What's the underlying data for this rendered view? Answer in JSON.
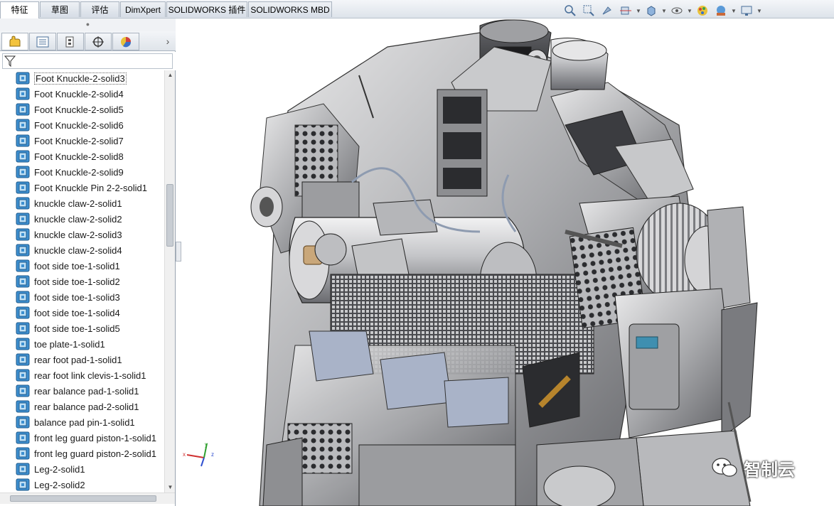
{
  "tabs": [
    {
      "label": "特征",
      "active": true
    },
    {
      "label": "草图",
      "active": false
    },
    {
      "label": "评估",
      "active": false
    },
    {
      "label": "DimXpert",
      "active": false
    },
    {
      "label": "SOLIDWORKS 插件",
      "active": false
    },
    {
      "label": "SOLIDWORKS MBD",
      "active": false
    }
  ],
  "hud_icons": [
    "zoom-to-fit-icon",
    "zoom-area-icon",
    "previous-view-icon",
    "section-view-icon",
    "dynamic-annotation-icon",
    "view-orientation-icon",
    "display-style-icon",
    "hide-show-icon",
    "edit-appearance-icon",
    "apply-scene-icon",
    "view-settings-icon"
  ],
  "panel_tabs": [
    "feature-manager-icon",
    "property-manager-icon",
    "configuration-manager-icon",
    "dimxpert-manager-icon",
    "display-manager-icon"
  ],
  "tree_items": [
    "Foot Knuckle-2-solid3",
    "Foot Knuckle-2-solid4",
    "Foot Knuckle-2-solid5",
    "Foot Knuckle-2-solid6",
    "Foot Knuckle-2-solid7",
    "Foot Knuckle-2-solid8",
    "Foot Knuckle-2-solid9",
    "Foot Knuckle Pin 2-2-solid1",
    "knuckle claw-2-solid1",
    "knuckle claw-2-solid2",
    "knuckle claw-2-solid3",
    "knuckle claw-2-solid4",
    "foot side toe-1-solid1",
    "foot side toe-1-solid2",
    "foot side toe-1-solid3",
    "foot side toe-1-solid4",
    "foot side toe-1-solid5",
    "toe plate-1-solid1",
    "rear foot pad-1-solid1",
    "rear foot link clevis-1-solid1",
    "rear balance pad-1-solid1",
    "rear balance pad-2-solid1",
    "balance pad pin-1-solid1",
    "front leg guard piston-1-solid1",
    "front leg guard piston-2-solid1",
    "Leg-2-solid1",
    "Leg-2-solid2"
  ],
  "watermark": {
    "text": "智制云"
  },
  "colors": {
    "accent": "#2f6fb3",
    "part_icon": "#3d8fd0"
  }
}
